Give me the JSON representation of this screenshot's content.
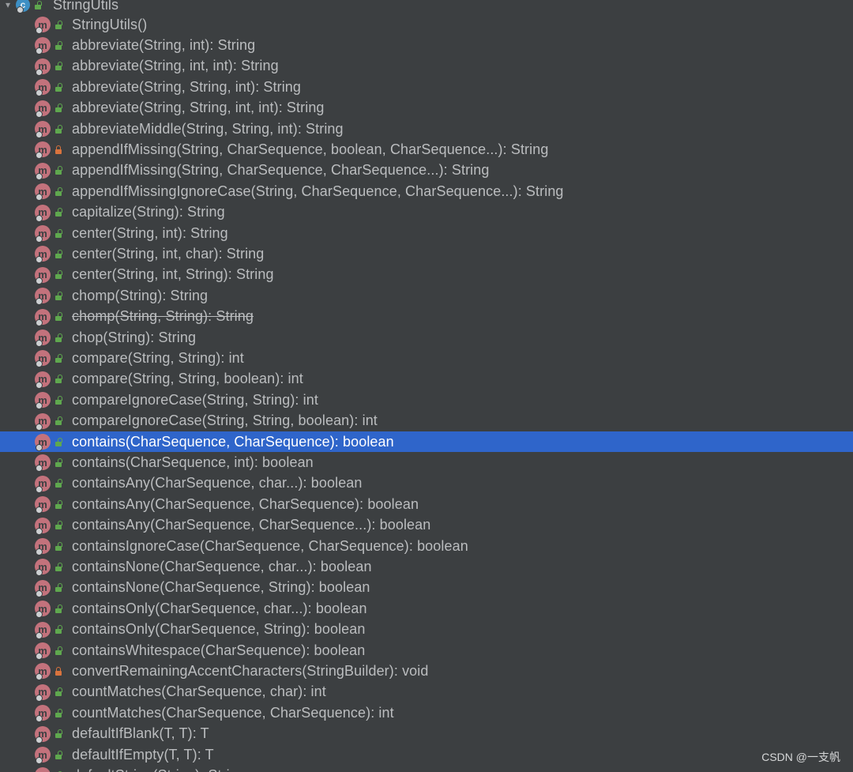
{
  "tree": {
    "class_node": {
      "label": "StringUtils",
      "icon": "class-icon"
    },
    "members": [
      {
        "label": "StringUtils()",
        "access": "public"
      },
      {
        "label": "abbreviate(String, int): String",
        "access": "public"
      },
      {
        "label": "abbreviate(String, int, int): String",
        "access": "public"
      },
      {
        "label": "abbreviate(String, String, int): String",
        "access": "public"
      },
      {
        "label": "abbreviate(String, String, int, int): String",
        "access": "public"
      },
      {
        "label": "abbreviateMiddle(String, String, int): String",
        "access": "public"
      },
      {
        "label": "appendIfMissing(String, CharSequence, boolean, CharSequence...): String",
        "access": "private"
      },
      {
        "label": "appendIfMissing(String, CharSequence, CharSequence...): String",
        "access": "public"
      },
      {
        "label": "appendIfMissingIgnoreCase(String, CharSequence, CharSequence...): String",
        "access": "public"
      },
      {
        "label": "capitalize(String): String",
        "access": "public"
      },
      {
        "label": "center(String, int): String",
        "access": "public"
      },
      {
        "label": "center(String, int, char): String",
        "access": "public"
      },
      {
        "label": "center(String, int, String): String",
        "access": "public"
      },
      {
        "label": "chomp(String): String",
        "access": "public"
      },
      {
        "label": "chomp(String, String): String",
        "access": "public",
        "deprecated": true
      },
      {
        "label": "chop(String): String",
        "access": "public"
      },
      {
        "label": "compare(String, String): int",
        "access": "public"
      },
      {
        "label": "compare(String, String, boolean): int",
        "access": "public"
      },
      {
        "label": "compareIgnoreCase(String, String): int",
        "access": "public"
      },
      {
        "label": "compareIgnoreCase(String, String, boolean): int",
        "access": "public"
      },
      {
        "label": "contains(CharSequence, CharSequence): boolean",
        "access": "public",
        "selected": true
      },
      {
        "label": "contains(CharSequence, int): boolean",
        "access": "public"
      },
      {
        "label": "containsAny(CharSequence, char...): boolean",
        "access": "public"
      },
      {
        "label": "containsAny(CharSequence, CharSequence): boolean",
        "access": "public"
      },
      {
        "label": "containsAny(CharSequence, CharSequence...): boolean",
        "access": "public"
      },
      {
        "label": "containsIgnoreCase(CharSequence, CharSequence): boolean",
        "access": "public"
      },
      {
        "label": "containsNone(CharSequence, char...): boolean",
        "access": "public"
      },
      {
        "label": "containsNone(CharSequence, String): boolean",
        "access": "public"
      },
      {
        "label": "containsOnly(CharSequence, char...): boolean",
        "access": "public"
      },
      {
        "label": "containsOnly(CharSequence, String): boolean",
        "access": "public"
      },
      {
        "label": "containsWhitespace(CharSequence): boolean",
        "access": "public"
      },
      {
        "label": "convertRemainingAccentCharacters(StringBuilder): void",
        "access": "private"
      },
      {
        "label": "countMatches(CharSequence, char): int",
        "access": "public"
      },
      {
        "label": "countMatches(CharSequence, CharSequence): int",
        "access": "public"
      },
      {
        "label": "defaultIfBlank(T, T): T",
        "access": "public"
      },
      {
        "label": "defaultIfEmpty(T, T): T",
        "access": "public"
      },
      {
        "label": "defaultString(String): String",
        "access": "public"
      }
    ]
  },
  "icons": {
    "method_glyph": "m",
    "class_glyph": "c",
    "chevron": "▾"
  },
  "colors": {
    "background": "#3c3f41",
    "selection": "#2f65ca",
    "method_icon": "#c3727c",
    "public_access": "#5fa84e",
    "private_access": "#d9733d"
  },
  "watermark": "CSDN @一支帆"
}
